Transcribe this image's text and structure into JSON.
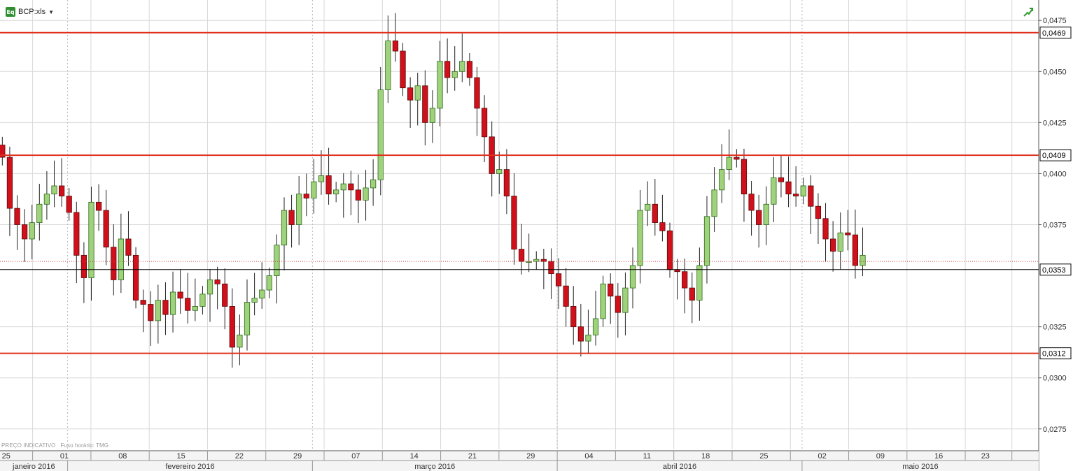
{
  "toolbar": {
    "symbol": "BCP:xls",
    "icon": "eq-icon",
    "icon_text": "Eq",
    "dropdown_icon": "caret-down-icon",
    "trend_icon": "trend-up-icon"
  },
  "footnote": {
    "price_note": "PREÇO INDICATIVO",
    "timezone_note": "Fuso horário: TMG"
  },
  "colors": {
    "up": "#9fd27a",
    "up_border": "#2e6b1e",
    "down": "#d0101a",
    "down_border": "#5a0a0a",
    "resistance": "#e0301e",
    "grid": "#d8d8d8"
  },
  "chart_data": {
    "type": "candlestick",
    "ylim": [
      0.0265,
      0.0485
    ],
    "y_ticks": [
      "0,0475",
      "0,0450",
      "0,0425",
      "0,0400",
      "0,0375",
      "0,0325",
      "0,0300",
      "0,0275"
    ],
    "y_tick_values": [
      0.0475,
      0.045,
      0.0425,
      0.04,
      0.0375,
      0.0325,
      0.03,
      0.0275
    ],
    "price_levels": [
      {
        "value": 0.0469,
        "label": "0,0469"
      },
      {
        "value": 0.0409,
        "label": "0,0409"
      },
      {
        "value": 0.0312,
        "label": "0,0312"
      }
    ],
    "last_price": {
      "value": 0.0353,
      "label": "0,0353"
    },
    "dotted_level": 0.0357,
    "x_ticks": [
      {
        "label": "25",
        "day": 2
      },
      {
        "label": "01",
        "day": 7
      },
      {
        "label": "08",
        "day": 12
      },
      {
        "label": "15",
        "day": 17
      },
      {
        "label": "22",
        "day": 22
      },
      {
        "label": "29",
        "day": 27
      },
      {
        "label": "07",
        "day": 32
      },
      {
        "label": "14",
        "day": 37
      },
      {
        "label": "21",
        "day": 42
      },
      {
        "label": "29",
        "day": 47
      },
      {
        "label": "04",
        "day": 52
      },
      {
        "label": "11",
        "day": 57
      },
      {
        "label": "18",
        "day": 62
      },
      {
        "label": "25",
        "day": 67
      },
      {
        "label": "02",
        "day": 72
      },
      {
        "label": "09",
        "day": 77
      },
      {
        "label": "16",
        "day": 82
      },
      {
        "label": "23",
        "day": 86
      }
    ],
    "months": [
      {
        "label": "janeiro 2016",
        "start": -1,
        "end": 5
      },
      {
        "label": "fevereiro 2016",
        "start": 5,
        "end": 26
      },
      {
        "label": "março 2016",
        "start": 26,
        "end": 47
      },
      {
        "label": "abril 2016",
        "start": 47,
        "end": 68
      },
      {
        "label": "maio 2016",
        "start": 68,
        "end": 89
      }
    ],
    "x_range": [
      -0.8,
      88.3
    ],
    "close_series": [
      0.0408,
      0.0383,
      0.0375,
      0.0368,
      0.0376,
      0.0385,
      0.039,
      0.0394,
      0.0389,
      0.0381,
      0.036,
      0.0349,
      0.0386,
      0.0382,
      0.0364,
      0.0348,
      0.0368,
      0.036,
      0.0338,
      0.0336,
      0.0328,
      0.0338,
      0.0331,
      0.0342,
      0.0339,
      0.0333,
      0.0335,
      0.0341,
      0.0348,
      0.0346,
      0.0335,
      0.0315,
      0.0321,
      0.0337,
      0.0339,
      0.0343,
      0.035,
      0.0365,
      0.0382,
      0.0375,
      0.039,
      0.0388,
      0.0396,
      0.0399,
      0.039,
      0.0392,
      0.0395,
      0.0392,
      0.0387,
      0.0393,
      0.0397,
      0.0441,
      0.0465,
      0.046,
      0.0442,
      0.0436,
      0.0443,
      0.0425,
      0.0432,
      0.0455,
      0.0447,
      0.045,
      0.0455,
      0.0447,
      0.0432,
      0.0418,
      0.04,
      0.0402,
      0.0389,
      0.0363,
      0.0357,
      0.0357,
      0.0358,
      0.0357,
      0.0351,
      0.0345,
      0.0335,
      0.0325,
      0.0318,
      0.0321,
      0.0329,
      0.0346,
      0.034,
      0.0332,
      0.0344,
      0.0355,
      0.0382,
      0.0385,
      0.0376,
      0.0372,
      0.0353,
      0.0352,
      0.0344,
      0.0338,
      0.0355,
      0.0379,
      0.0392,
      0.0402,
      0.0408,
      0.0407,
      0.039,
      0.0382,
      0.0375,
      0.0385,
      0.0398,
      0.0396,
      0.039,
      0.0389,
      0.0394,
      0.0384,
      0.0378,
      0.0368,
      0.0362,
      0.0371,
      0.037,
      0.0355,
      0.036
    ]
  }
}
